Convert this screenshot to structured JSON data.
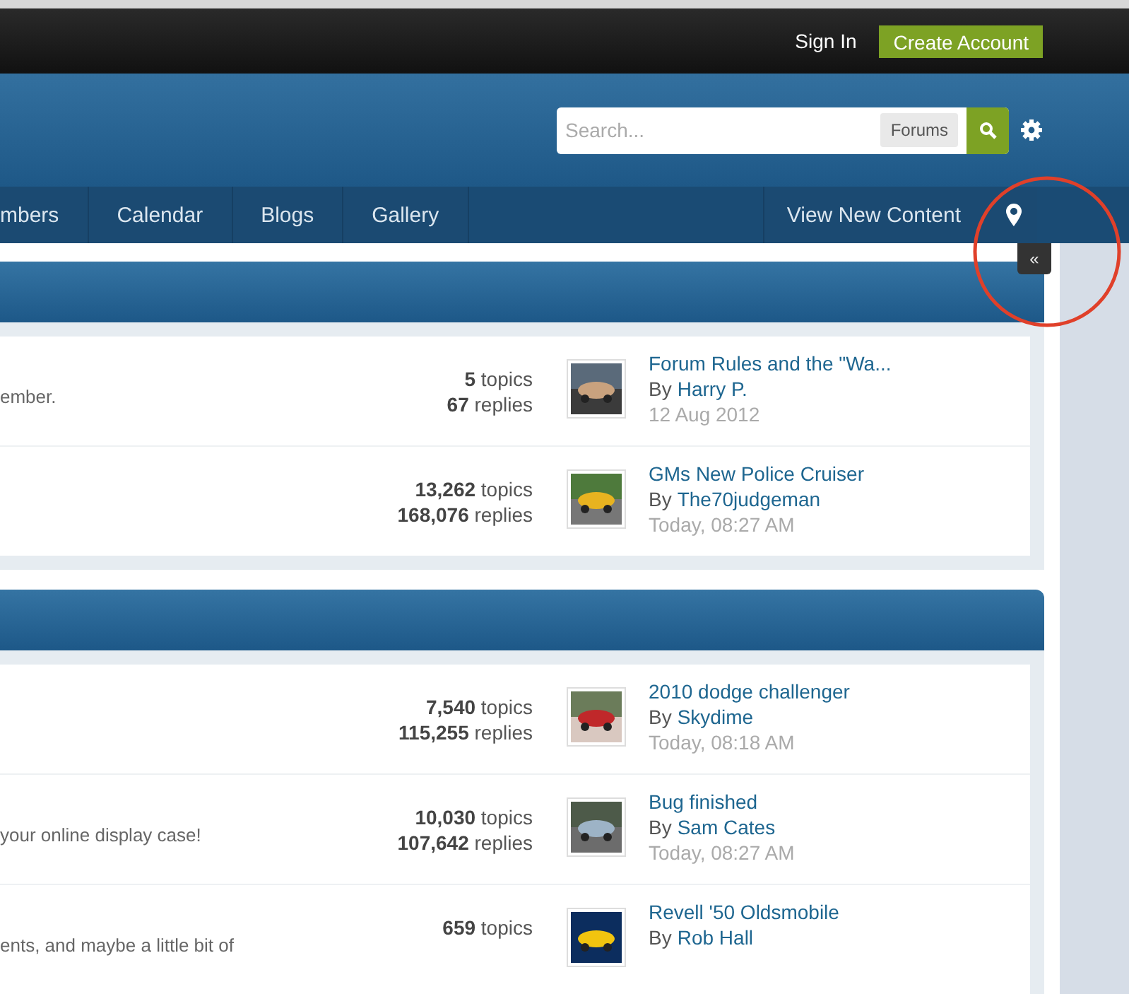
{
  "top_bar": {
    "links": [
      {
        "label": "Sign In",
        "kind": "link"
      },
      {
        "label": "Create Account",
        "kind": "button"
      }
    ]
  },
  "search": {
    "placeholder": "Search...",
    "scope": "Forums"
  },
  "nav": {
    "items": [
      {
        "label": "mbers"
      },
      {
        "label": "Calendar"
      },
      {
        "label": "Blogs"
      },
      {
        "label": "Gallery"
      }
    ],
    "right_items": [
      {
        "label": "View New Content"
      }
    ]
  },
  "tooltip": {
    "label": "«"
  },
  "categories": [
    {
      "forums": [
        {
          "description": "ember.",
          "topics": "**5** topics",
          "replies": "**67** replies",
          "last_post": {
            "title": "Forum Rules and the \"Wa...",
            "author_prefix": "By",
            "author": "Harry P.",
            "time": "12 Aug 2012"
          }
        },
        {
          "topics": "**13,262** topics",
          "replies": "**168,076** replies",
          "last_post": {
            "title": "GMs New Police Cruiser",
            "author_prefix": "By",
            "author": "The70judgeman",
            "time": "Today, 08:27 AM"
          }
        }
      ]
    },
    {
      "forums": [
        {
          "topics": "**7,540** topics",
          "replies": "**115,255** replies",
          "last_post": {
            "title": "2010 dodge challenger",
            "author_prefix": "By",
            "author": "Skydime",
            "time": "Today, 08:18 AM"
          }
        },
        {
          "description": "your online display case!",
          "topics": "**10,030** topics",
          "replies": "**107,642** replies",
          "last_post": {
            "title": "Bug finished",
            "author_prefix": "By",
            "author": "Sam Cates",
            "time": "Today, 08:27 AM"
          }
        },
        {
          "description": "ents, and maybe a little bit of",
          "topics": "**659** topics",
          "last_post": {
            "title": "Revell '50 Oldsmobile",
            "author_prefix": "By",
            "author": "Rob Hall"
          }
        }
      ]
    }
  ]
}
